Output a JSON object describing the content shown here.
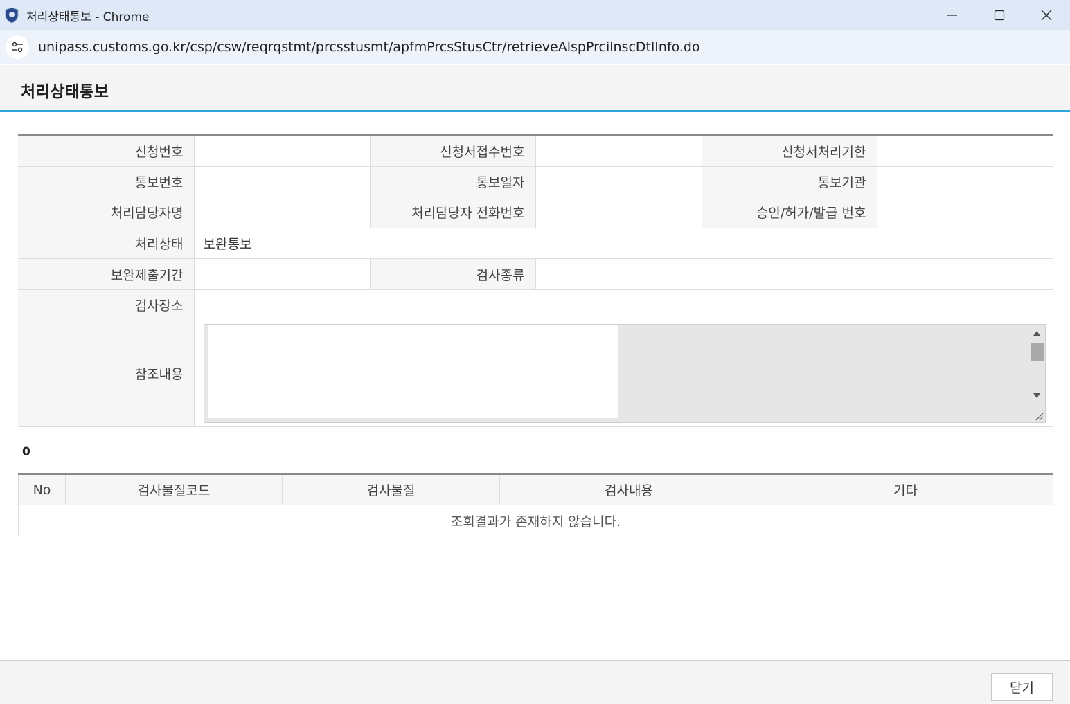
{
  "window": {
    "title": "처리상태통보 - Chrome",
    "url": "unipass.customs.go.kr/csp/csw/reqrqstmt/prcsstusmt/apfmPrcsStusCtr/retrieveAlspPrcilnscDtlInfo.do"
  },
  "page": {
    "title": "처리상태통보"
  },
  "info": {
    "labels": {
      "app_no": "신청번호",
      "receipt_no": "신청서접수번호",
      "deadline": "신청서처리기한",
      "notice_no": "통보번호",
      "notice_date": "통보일자",
      "notice_org": "통보기관",
      "officer_name": "처리담당자명",
      "officer_phone": "처리담당자 전화번호",
      "approval_no": "승인/허가/발급 번호",
      "status": "처리상태",
      "supplement_period": "보완제출기간",
      "inspection_type": "검사종류",
      "inspection_place": "검사장소",
      "reference": "참조내용"
    },
    "values": {
      "app_no": "",
      "receipt_no": "",
      "deadline": "",
      "notice_no": "",
      "notice_date": "",
      "notice_org": "",
      "officer_name": "",
      "officer_phone": "",
      "approval_no": "",
      "status": "보완통보",
      "supplement_period": "",
      "inspection_type": "",
      "inspection_place": "",
      "reference": ""
    }
  },
  "list": {
    "count": "0",
    "columns": [
      "No",
      "검사물질코드",
      "검사물질",
      "검사내용",
      "기타"
    ],
    "empty_message": "조회결과가 존재하지 않습니다."
  },
  "footer": {
    "close_label": "닫기"
  },
  "colors": {
    "accent": "#2aa6d8",
    "titlebar": "#dfe8f6"
  }
}
